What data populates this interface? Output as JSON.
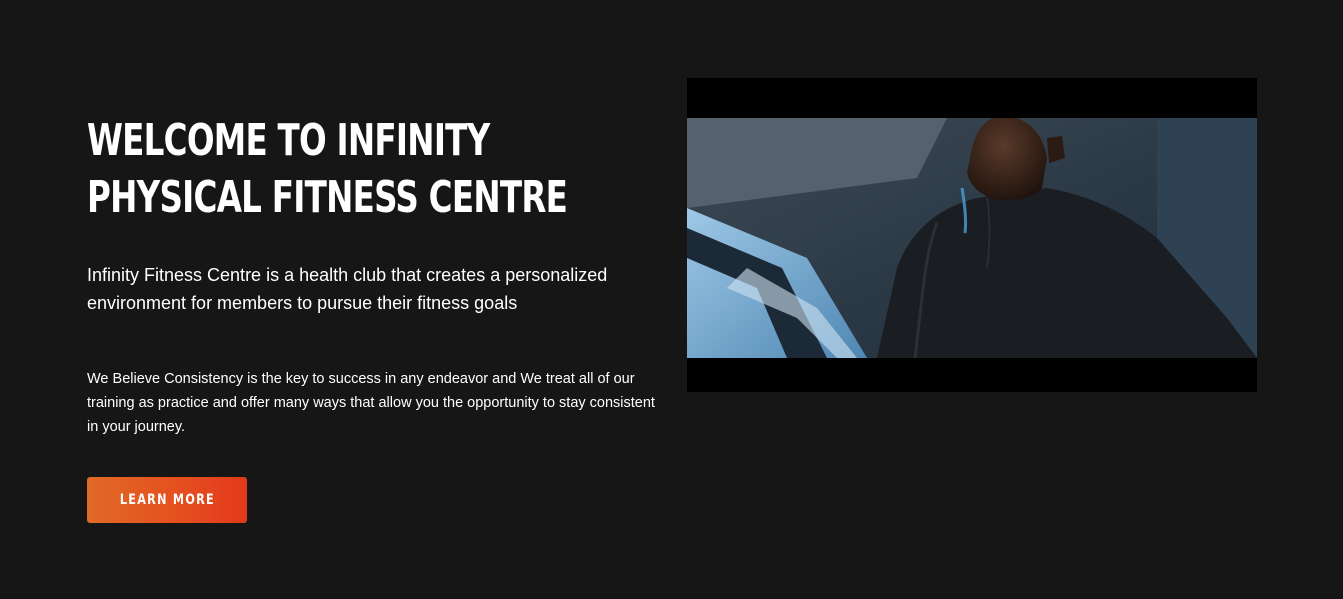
{
  "hero": {
    "title_line1": "WELCOME TO INFINITY",
    "title_line2": "PHYSICAL FITNESS CENTRE",
    "lead": "Infinity Fitness Centre is a health club that creates a personalized environment for members to pursue their fitness goals",
    "body": "We Believe Consistency is the key to success in any endeavor and We treat all of our training as practice and offer many ways that allow you the opportunity to stay consistent in your journey.",
    "cta_label": "LEARN MORE"
  },
  "colors": {
    "background": "#161616",
    "accent_start": "#e06a26",
    "accent_end": "#e23a1c",
    "text": "#ffffff"
  }
}
